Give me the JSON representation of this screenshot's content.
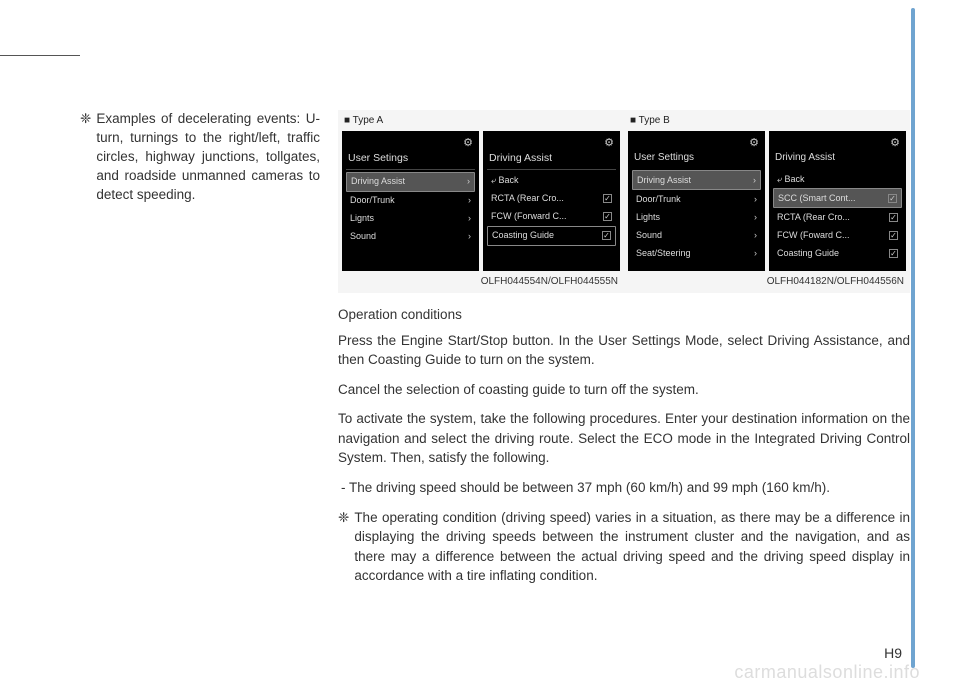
{
  "left": {
    "bullet_symbol": "❈",
    "bullet_text": "Examples of decelerating events: U-turn, turnings to the right/left, traffic circles, highway junctions, tollgates, and roadside unmanned cameras to detect speeding."
  },
  "figures": {
    "typeA": {
      "label": "■ Type A",
      "screen1": {
        "title": "User Setings",
        "items": [
          {
            "label": "Driving Assist",
            "right": "›",
            "cls": "highlighted"
          },
          {
            "label": "Door/Trunk",
            "right": "›"
          },
          {
            "label": "Lignts",
            "right": "›"
          },
          {
            "label": "Sound",
            "right": "›"
          }
        ]
      },
      "screen2": {
        "title": "Driving Assist",
        "items": [
          {
            "label": "⤶ Back",
            "right": ""
          },
          {
            "label": "RCTA (Rear Cro...",
            "right": "✓"
          },
          {
            "label": "FCW (Forward C...",
            "right": "✓"
          },
          {
            "label": "Coasting Guide",
            "right": "✓",
            "cls": "boxed"
          }
        ]
      },
      "caption": "OLFH044554N/OLFH044555N"
    },
    "typeB": {
      "label": "■ Type B",
      "screen1": {
        "title": "User Settings",
        "items": [
          {
            "label": "Driving Assist",
            "right": "›",
            "cls": "highlighted"
          },
          {
            "label": "Door/Trunk",
            "right": "›"
          },
          {
            "label": "Lights",
            "right": "›"
          },
          {
            "label": "Sound",
            "right": "›"
          },
          {
            "label": "Seat/Steering",
            "right": "›"
          }
        ]
      },
      "screen2": {
        "title": "Driving Assist",
        "items": [
          {
            "label": "⤶ Back",
            "right": ""
          },
          {
            "label": "SCC (Smart Cont...",
            "right": "✓",
            "cls": "highlighted"
          },
          {
            "label": "RCTA (Rear Cro...",
            "right": "✓"
          },
          {
            "label": "FCW (Foward C...",
            "right": "✓"
          },
          {
            "label": "Coasting Guide",
            "right": "✓"
          }
        ]
      },
      "caption": "OLFH044182N/OLFH044556N"
    }
  },
  "body": {
    "heading": "Operation conditions",
    "p1": "Press the Engine Start/Stop button. In the User Settings Mode, select Driving Assistance, and then Coasting Guide to turn on the system.",
    "p2": "Cancel the selection of coasting guide to turn off the system.",
    "p3": "To activate the system, take the following procedures. Enter your destination information on the navigation and select the driving route. Select the ECO mode in the Integrated Driving Control System. Then, satisfy the following.",
    "li1": "- The driving speed should be between 37 mph (60 km/h) and 99 mph (160 km/h).",
    "note_symbol": "❈",
    "note": "The operating condition (driving speed) varies in a situation, as there may be a difference in displaying the driving speeds between the instrument cluster and the navigation, and as there may a difference between the actual driving speed and the driving speed display in accordance with a tire inflating condition."
  },
  "page_number": "H9",
  "watermark": "carmanualsonline.info"
}
